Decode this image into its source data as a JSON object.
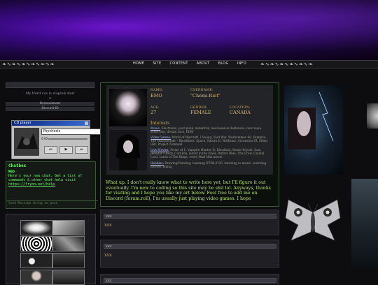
{
  "nav": {
    "items": [
      "HOME",
      "SITE",
      "CONTENT",
      "ABOUT",
      "BLOG",
      "INFO"
    ]
  },
  "left": {
    "status_line": "My third css is stapled shut",
    "side_rows": [
      "Bemusement",
      "Discord ID"
    ],
    "tiny": "▾"
  },
  "cd_player": {
    "title": "CD player",
    "track": "Psychosis",
    "time_start": "0:00",
    "time_end": "5:16",
    "buttons": [
      "⏮",
      "▶",
      "⏭"
    ]
  },
  "chat": {
    "title": "Chatbox",
    "author": "Web",
    "message": "Here's your new chat. Get a list of commands & other chat help visit",
    "link": "https://fryon.net/help",
    "footer": "Send Message Using to post"
  },
  "profile": {
    "name_label": "NAME:",
    "name": "EMO",
    "username_label": "USERNAME:",
    "username": "\"Chemi-Riot\"",
    "age_label": "AGE:",
    "age": "27",
    "gender_label": "GENDER:",
    "gender": "FEMALE",
    "location_label": "LOCATION:",
    "location": "CANADA",
    "interests_heading": "Interests",
    "interests": [
      {
        "key": "Music:",
        "text": "Electronic, post-punk, industrial, neoclassical darkwave, new wave, synth-pop, dream rock, EDM"
      },
      {
        "key": "Video Games:",
        "text": "World of Warcraft, I Swing, Void War, Warhammer 40, Vampire: The Masquerade – Bloodlines, Space, Saturn II, Wolfrune, Ascension III, Silent Hill, Project Zomboid"
      },
      {
        "key": "Live Movies:",
        "text": "Prime of 1, Vampire Hunter D: Bloodlust, Battle Royale, Saw, Jennifer's Body, Coraline, Ghost in the Shell, Perfect Blue, The Crow, Crystal Lord, Lords of The Rings, every Mad Max movie"
      },
      {
        "key": "Hobbies:",
        "text": "Drawing/Painting, learning HTML/CSS, listening to music, watching movies, hiking"
      }
    ],
    "bio": "What up. I don't really know what to write here yet, but I'll figure it out eventually. I'm new to coding so this site may be shit lol. Anyways, thanks for visiting and I hope you like my art below. Feel free to add me on Discord (forum.roll), I'm usually just playing video games. I hope"
  },
  "boxes": [
    {
      "title": "XXX",
      "text": "XXX"
    },
    {
      "title": "XXX",
      "text": "XXX"
    },
    {
      "title": "XXX",
      "text": ""
    }
  ]
}
